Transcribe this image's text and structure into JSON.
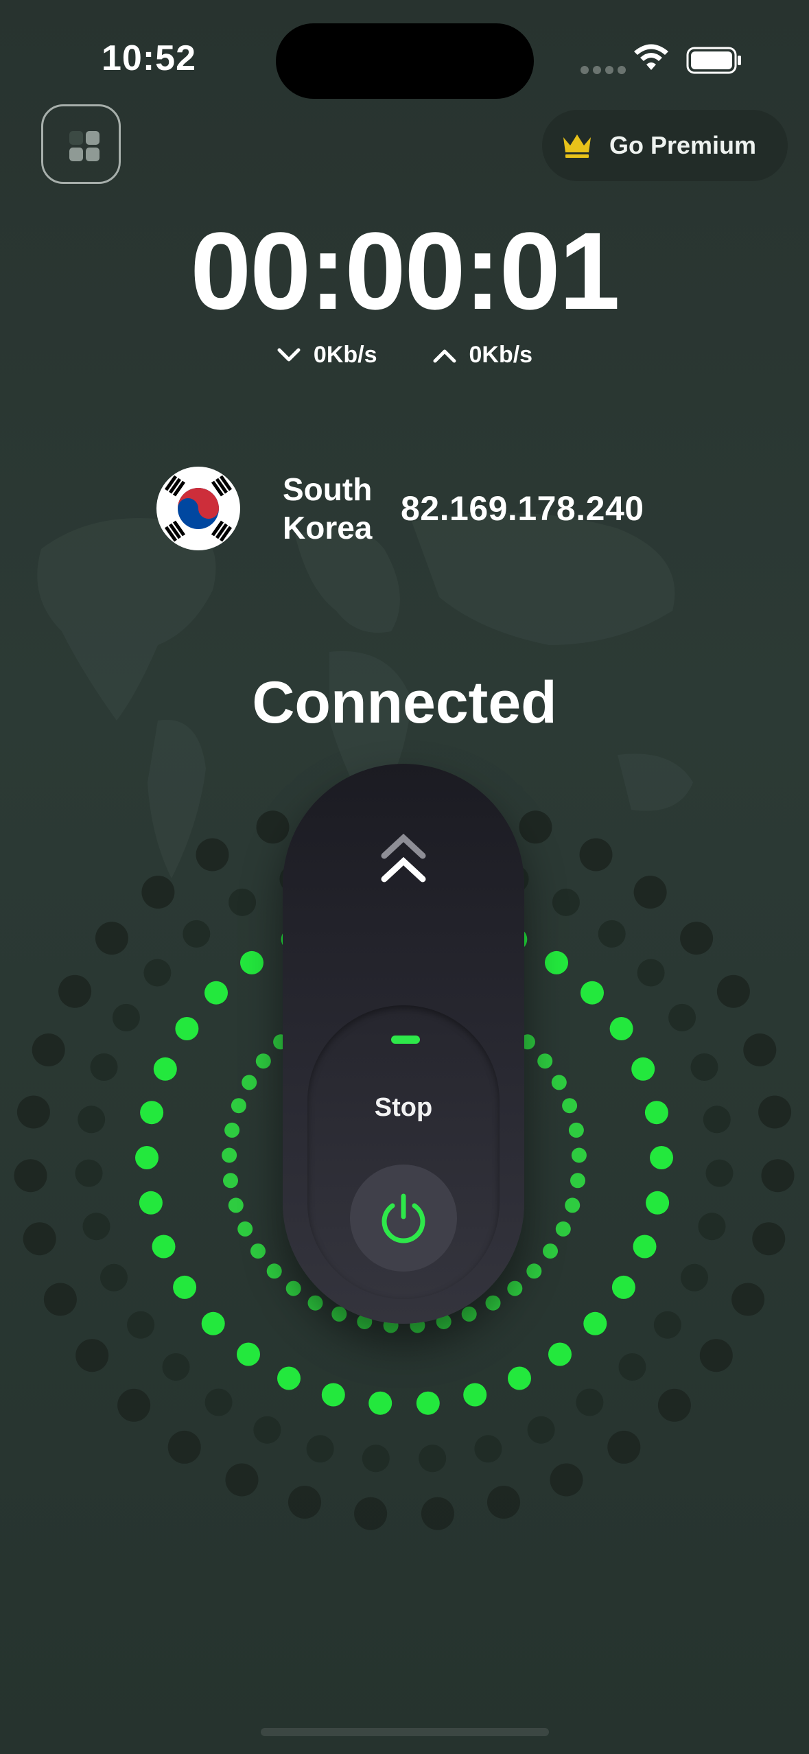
{
  "status_bar": {
    "time": "10:52"
  },
  "header": {
    "premium_label": "Go Premium"
  },
  "session": {
    "timer": "00:00:01",
    "download_speed": "0Kb/s",
    "upload_speed": "0Kb/s"
  },
  "server": {
    "country": "South Korea",
    "ip": "82.169.178.240"
  },
  "connection": {
    "status": "Connected",
    "stop_label": "Stop"
  },
  "colors": {
    "accent_green": "#2ee84a",
    "background": "#28332f",
    "premium_gold": "#e8c21a"
  },
  "icons": [
    "menu-icon",
    "crown-icon",
    "download-arrow-icon",
    "upload-arrow-icon",
    "power-icon",
    "chevron-up-icon",
    "wifi-icon",
    "battery-icon",
    "south-korea-flag-icon"
  ]
}
